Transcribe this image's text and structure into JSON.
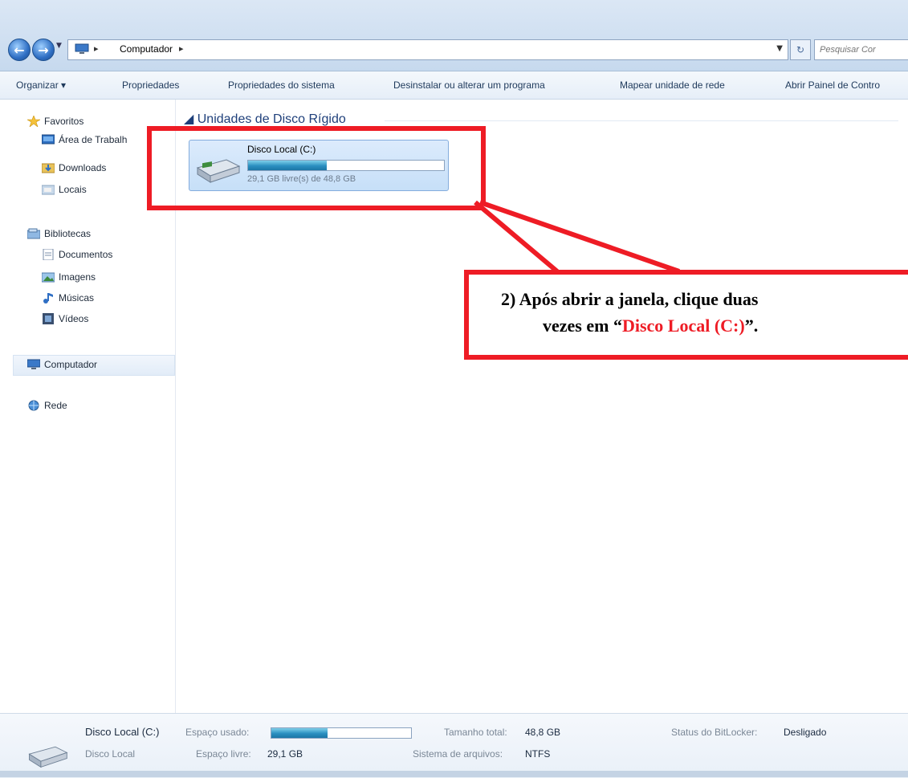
{
  "address_bar": {
    "crumb": "Computador",
    "search_placeholder": "Pesquisar Cor"
  },
  "command_bar": {
    "items": [
      "Organizar ▾",
      "Propriedades",
      "Propriedades do sistema",
      "Desinstalar ou alterar um programa",
      "Mapear unidade de rede",
      "Abrir Painel de Contro"
    ]
  },
  "navigation": {
    "favorites": "Favoritos",
    "desktop": "Área de Trabalh",
    "downloads": "Downloads",
    "locais": "Locais",
    "libraries": "Bibliotecas",
    "documents": "Documentos",
    "images": "Imagens",
    "music": "Músicas",
    "videos": "Vídeos",
    "computer": "Computador",
    "network": "Rede"
  },
  "content": {
    "group_header": "Unidades de Disco Rígido",
    "drive": {
      "name": "Disco Local (C:)",
      "free_text": "29,1 GB livre(s) de 48,8 GB",
      "used_fraction": 0.4
    }
  },
  "callout": {
    "line1": "2)  Após abrir a janela, clique duas",
    "line2_prefix": "vezes em “",
    "line2_highlight": "Disco Local (C:)",
    "line2_suffix": "”.",
    "highlight_color": "#ee1c25"
  },
  "details": {
    "name": "Disco Local (C:)",
    "type": "Disco Local",
    "used_label": "Espaço usado:",
    "free_label": "Espaço livre:",
    "free_value": "29,1 GB",
    "total_label": "Tamanho total:",
    "total_value": "48,8 GB",
    "fs_label": "Sistema de arquivos:",
    "fs_value": "NTFS",
    "bitlocker_label": "Status do BitLocker:",
    "bitlocker_value": "Desligado",
    "used_fraction": 0.4
  },
  "colors": {
    "accent": "#1e395b",
    "annotation": "#ee1c25"
  }
}
